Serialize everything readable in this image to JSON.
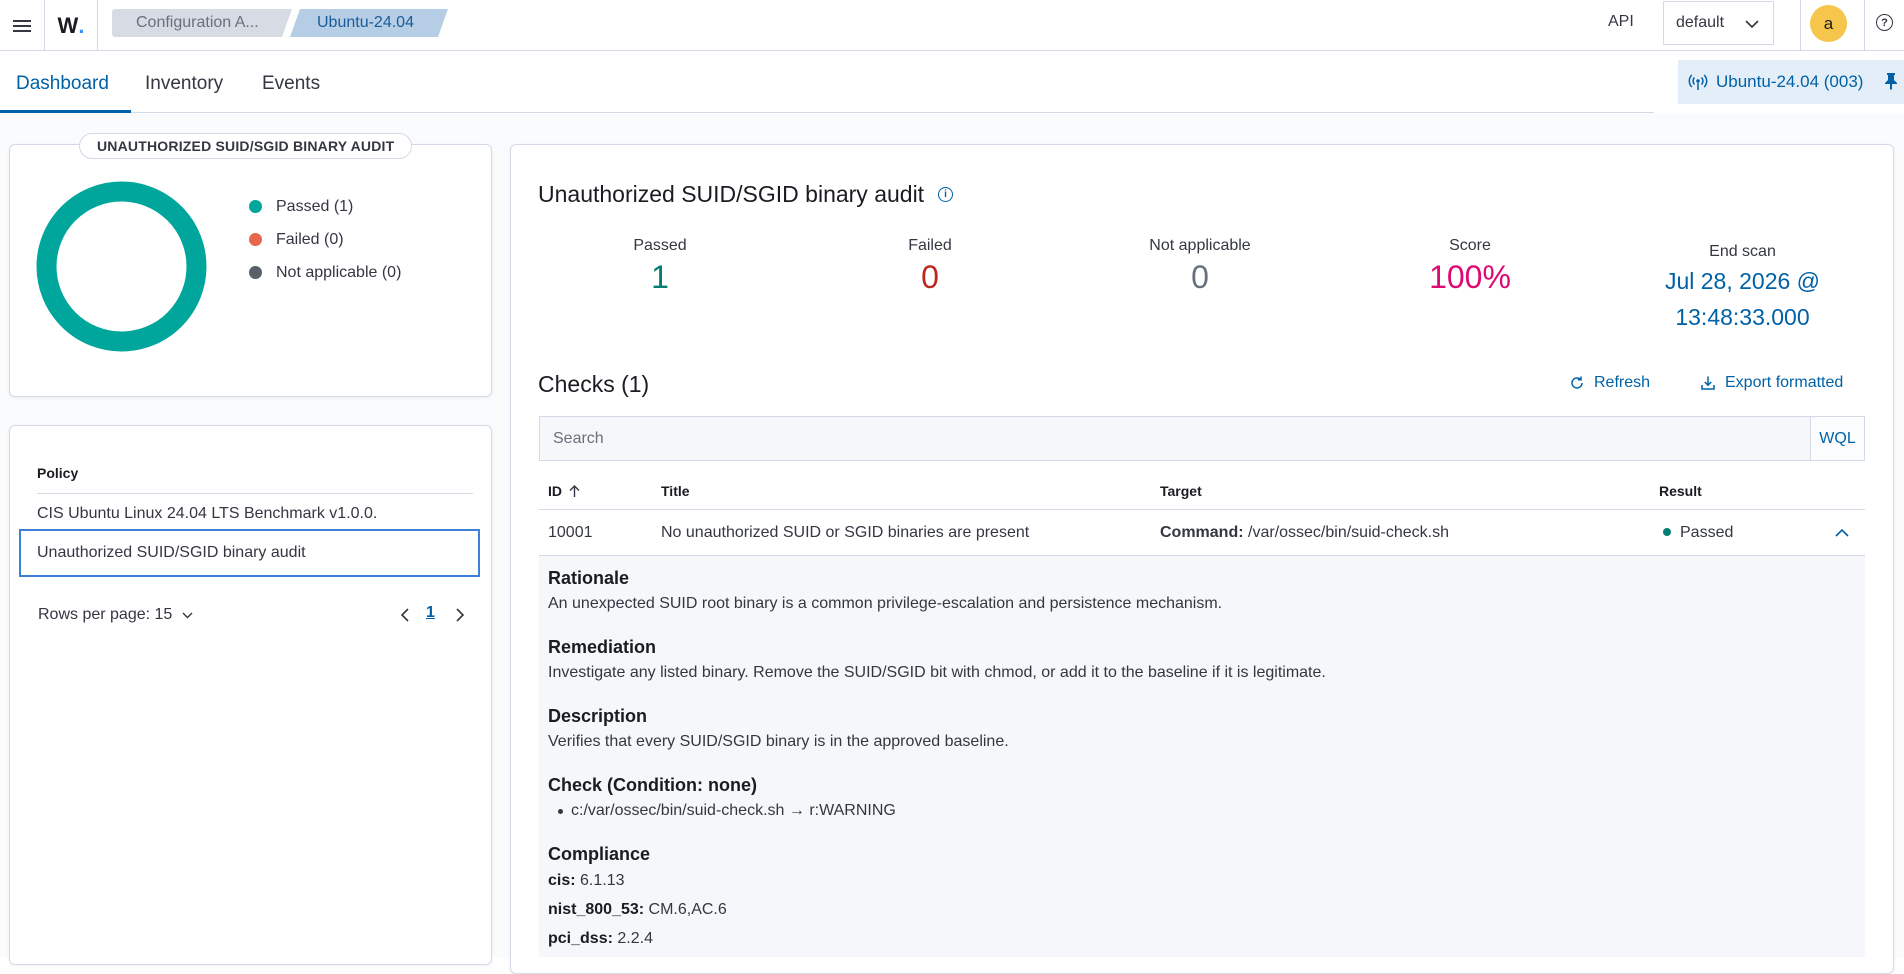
{
  "header": {
    "logo_text": "W",
    "logo_dot": ".",
    "breadcrumb": [
      "Configuration A...",
      "Ubuntu-24.04"
    ],
    "api_label": "API",
    "selector_value": "default",
    "avatar_letter": "a",
    "help_glyph": "?"
  },
  "tabs": [
    {
      "label": "Dashboard",
      "active": true
    },
    {
      "label": "Inventory",
      "active": false
    },
    {
      "label": "Events",
      "active": false
    }
  ],
  "agent_pill": {
    "label": "Ubuntu-24.04 (003)"
  },
  "summary_panel": {
    "title": "UNAUTHORIZED SUID/SGID BINARY AUDIT",
    "legend": [
      {
        "label": "Passed (1)",
        "color": "#00a69b"
      },
      {
        "label": "Failed (0)",
        "color": "#e7664c"
      },
      {
        "label": "Not applicable (0)",
        "color": "#5a6069"
      }
    ],
    "donut_color": "#00a69b"
  },
  "policy_panel": {
    "header": "Policy",
    "rows": [
      "CIS Ubuntu Linux 24.04 LTS Benchmark v1.0.0.",
      "Unauthorized SUID/SGID binary audit"
    ],
    "rows_per_page": "Rows per page: 15",
    "current_page": "1"
  },
  "detail": {
    "title": "Unauthorized SUID/SGID binary audit",
    "stats": {
      "passed": {
        "label": "Passed",
        "value": "1",
        "color": "#017d73"
      },
      "failed": {
        "label": "Failed",
        "value": "0",
        "color": "#bd271e"
      },
      "not_applicable": {
        "label": "Not applicable",
        "value": "0",
        "color": "#69707d"
      },
      "score": {
        "label": "Score",
        "value": "100%",
        "color": "#dd0a73"
      },
      "end_scan": {
        "label": "End scan",
        "value_line1": "Jul 28, 2026 @",
        "value_line2": "13:48:33.000"
      }
    }
  },
  "checks": {
    "title": "Checks (1)",
    "refresh_label": "Refresh",
    "export_label": "Export formatted",
    "search_placeholder": "Search",
    "wql_label": "WQL",
    "columns": {
      "id": "ID",
      "title": "Title",
      "target": "Target",
      "result": "Result"
    },
    "row": {
      "id": "10001",
      "title": "No unauthorized SUID or SGID binaries are present",
      "target_label": "Command:",
      "target_value": "/var/ossec/bin/suid-check.sh",
      "result": "Passed"
    },
    "expanded": {
      "rationale_h": "Rationale",
      "rationale": "An unexpected SUID root binary is a common privilege-escalation and persistence mechanism.",
      "remediation_h": "Remediation",
      "remediation": "Investigate any listed binary. Remove the SUID/SGID bit with chmod, or add it to the baseline if it is legitimate.",
      "description_h": "Description",
      "description": "Verifies that every SUID/SGID binary is in the approved baseline.",
      "check_h": "Check (Condition: none)",
      "check_rule": "c:/var/ossec/bin/suid-check.sh → r:WARNING",
      "compliance_h": "Compliance",
      "compliance": [
        {
          "key": "cis:",
          "value": "6.1.13"
        },
        {
          "key": "nist_800_53:",
          "value": "CM.6,AC.6"
        },
        {
          "key": "pci_dss:",
          "value": "2.2.4"
        }
      ]
    }
  }
}
